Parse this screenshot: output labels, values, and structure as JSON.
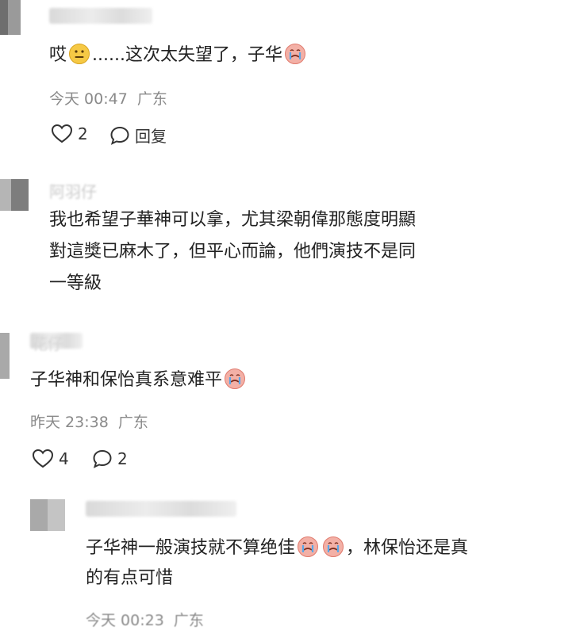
{
  "comments": [
    {
      "text_a": "哎",
      "text_b": "......这次太失望了，子华",
      "time": "今天 00:47",
      "location": "广东",
      "like_count": "2",
      "reply_label": "回复"
    },
    {
      "author": "阿羽仔",
      "lines": [
        "我也希望子華神可以拿，尤其梁朝偉那態度明顯",
        "對這獎已麻木了，但平心而論，他們演技不是同",
        "一等級"
      ]
    },
    {
      "author": "花仔",
      "text": "子华神和保怡真系意难平",
      "time": "昨天 23:38",
      "location": "广东",
      "like_count": "4",
      "reply_count": "2"
    },
    {
      "line1_a": "子华神一般演技就不算绝佳",
      "line1_b": "，林保怡还是真",
      "line2": "的有点可惜",
      "time": "今天 00:23",
      "location": "广东"
    }
  ],
  "icons": {
    "like": "heart-outline-icon",
    "reply": "speech-bubble-icon",
    "emoji_speechless": "speechless-face-emoji",
    "emoji_crying": "crying-face-emoji"
  },
  "colors": {
    "meta": "#8a8a8a",
    "text": "#222222"
  }
}
